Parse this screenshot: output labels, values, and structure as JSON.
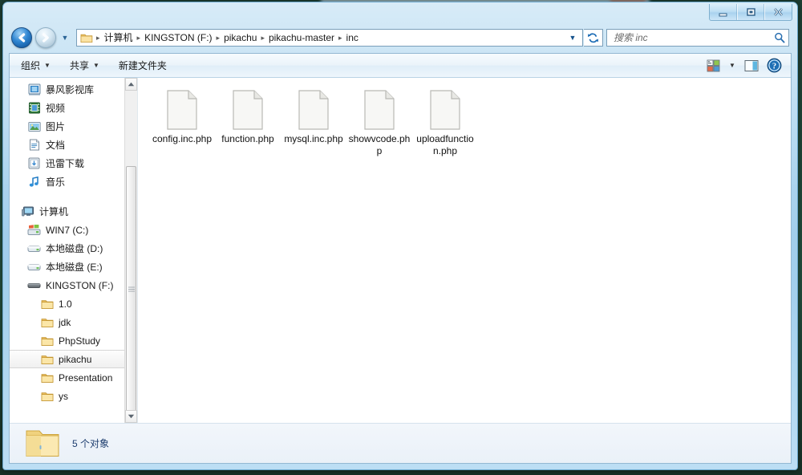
{
  "window": {
    "controls": {
      "minimize": "Minimize",
      "maximize": "Maximize",
      "close": "Close"
    }
  },
  "nav": {
    "back_label": "后退",
    "forward_label": "前进",
    "history_label": "最近访问的位置",
    "refresh_label": "刷新",
    "breadcrumbs": [
      "计算机",
      "KINGSTON (F:)",
      "pikachu",
      "pikachu-master",
      "inc"
    ],
    "separator": "▸"
  },
  "search": {
    "placeholder": "搜索 inc",
    "value": "",
    "icon": "search-icon"
  },
  "toolbar": {
    "organize_label": "组织",
    "share_label": "共享",
    "new_folder_label": "新建文件夹",
    "caret": "▼",
    "view_icon": "view-options-icon",
    "view_caret": "▼",
    "preview_icon": "preview-pane-icon",
    "help_icon": "help-icon"
  },
  "sidebar": {
    "libraries": [
      {
        "label": "暴风影视库",
        "icon": "media-library-icon",
        "indent": 1
      },
      {
        "label": "视频",
        "icon": "video-icon",
        "indent": 1
      },
      {
        "label": "图片",
        "icon": "pictures-icon",
        "indent": 1
      },
      {
        "label": "文档",
        "icon": "documents-icon",
        "indent": 1
      },
      {
        "label": "迅雷下载",
        "icon": "downloads-icon",
        "indent": 1
      },
      {
        "label": "音乐",
        "icon": "music-icon",
        "indent": 1
      }
    ],
    "computer": [
      {
        "label": "计算机",
        "icon": "computer-icon",
        "indent": 0,
        "selected": false
      },
      {
        "label": "WIN7 (C:)",
        "icon": "windows-drive-icon",
        "indent": 1,
        "selected": false
      },
      {
        "label": "本地磁盘 (D:)",
        "icon": "drive-icon",
        "indent": 1,
        "selected": false
      },
      {
        "label": "本地磁盘 (E:)",
        "icon": "drive-icon",
        "indent": 1,
        "selected": false
      },
      {
        "label": "KINGSTON (F:)",
        "icon": "removable-drive-icon",
        "indent": 1,
        "selected": false
      },
      {
        "label": "1.0",
        "icon": "folder-icon",
        "indent": 2,
        "selected": false
      },
      {
        "label": "jdk",
        "icon": "folder-icon",
        "indent": 2,
        "selected": false
      },
      {
        "label": "PhpStudy",
        "icon": "folder-icon",
        "indent": 2,
        "selected": false
      },
      {
        "label": "pikachu",
        "icon": "folder-icon",
        "indent": 2,
        "selected": true
      },
      {
        "label": "Presentation",
        "icon": "folder-icon",
        "indent": 2,
        "selected": false
      },
      {
        "label": "ys",
        "icon": "folder-icon",
        "indent": 2,
        "selected": false
      }
    ],
    "scrollbar": {
      "up": "▲",
      "down": "▼"
    }
  },
  "files": [
    {
      "name": "config.inc.php",
      "icon": "blank-file-icon"
    },
    {
      "name": "function.php",
      "icon": "blank-file-icon"
    },
    {
      "name": "mysql.inc.php",
      "icon": "blank-file-icon"
    },
    {
      "name": "showvcode.php",
      "icon": "blank-file-icon"
    },
    {
      "name": "uploadfunction.php",
      "icon": "blank-file-icon"
    }
  ],
  "status": {
    "text": "5 个对象",
    "icon": "folder-icon"
  },
  "colors": {
    "frame": "#a8d4ee",
    "accent": "#2f86d2",
    "status_text": "#1d3d6e",
    "desktop": "#24503f"
  }
}
